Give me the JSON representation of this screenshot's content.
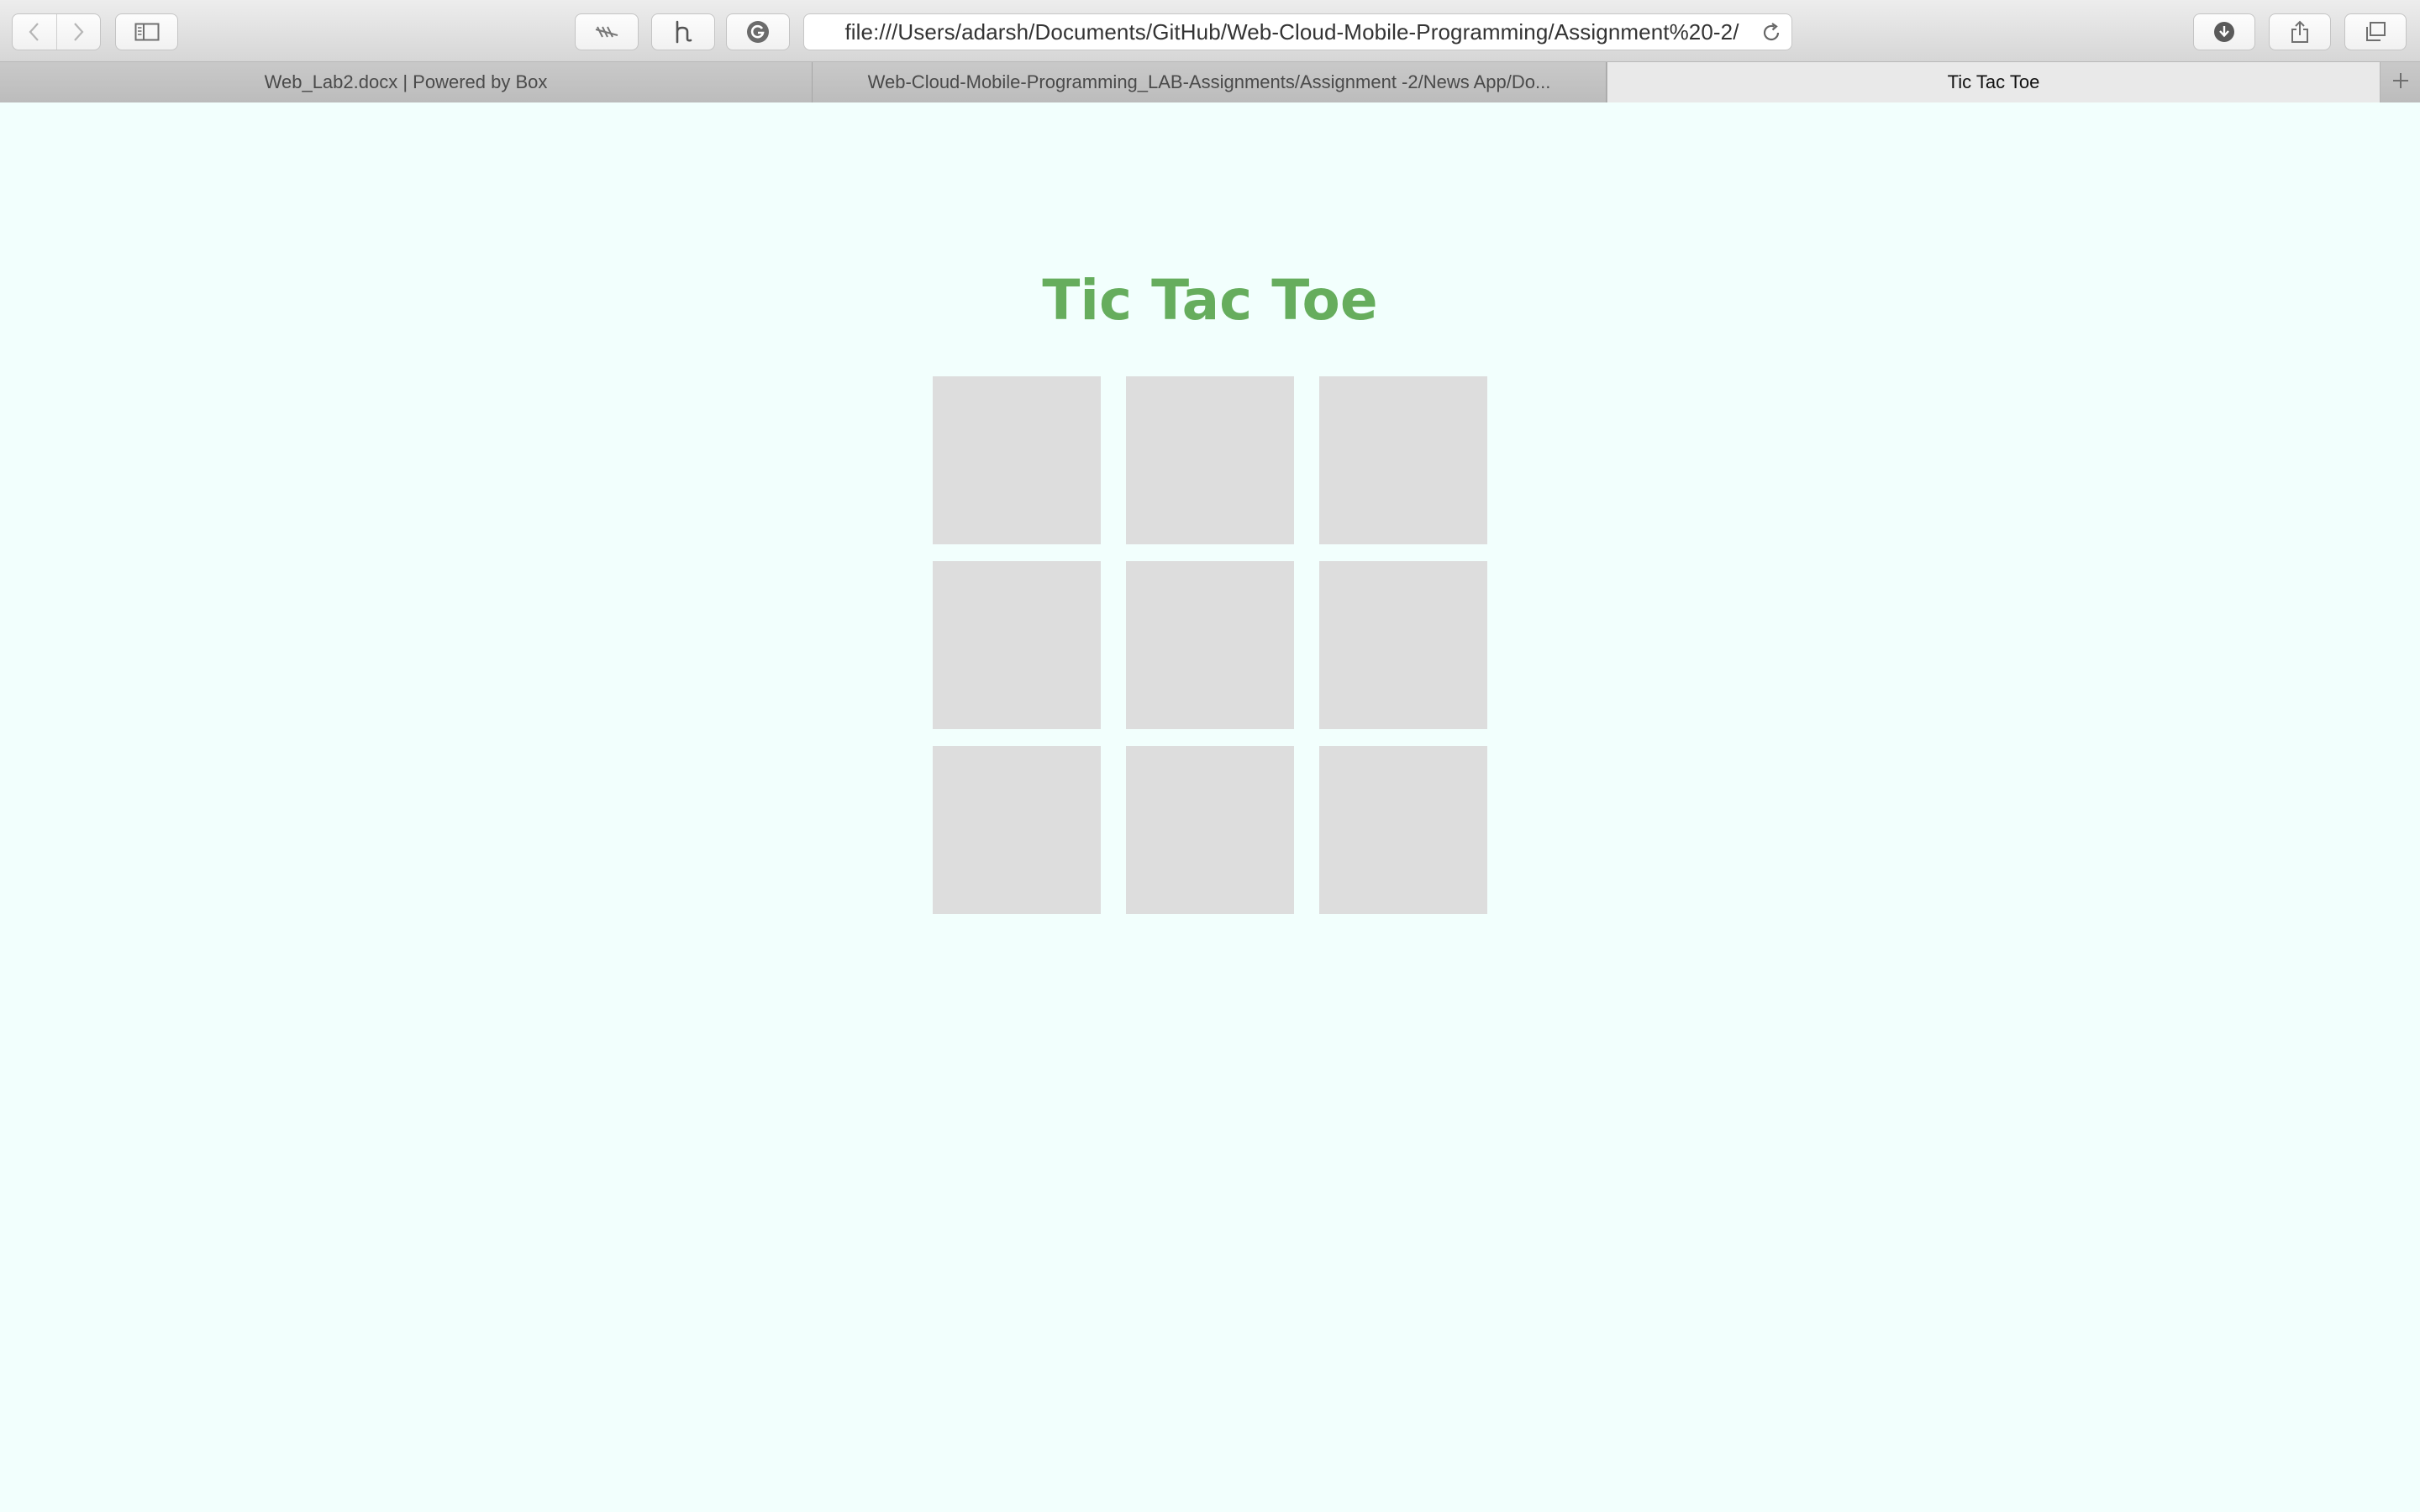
{
  "browser": {
    "address_bar": {
      "url": "file:///Users/adarsh/Documents/GitHub/Web-Cloud-Mobile-Programming/Assignment%20-2/"
    },
    "toolbar": {
      "icons": {
        "back": "chevron-left-icon",
        "forward": "chevron-right-icon",
        "sidebar": "sidebar-icon",
        "extension_1": "strikethrough-icon",
        "extension_2": "hypothesis-icon",
        "extension_3": "grammarly-icon",
        "reload": "reload-icon",
        "downloads": "download-icon",
        "share": "share-icon",
        "tabs_overview": "tabs-overview-icon",
        "new_tab": "plus-icon"
      }
    },
    "tabs": [
      {
        "label": "Web_Lab2.docx | Powered by Box",
        "active": false
      },
      {
        "label": "Web-Cloud-Mobile-Programming_LAB-Assignments/Assignment -2/News App/Do...",
        "active": false
      },
      {
        "label": "Tic Tac Toe",
        "active": true
      }
    ]
  },
  "page": {
    "title": "Tic Tac Toe",
    "board": {
      "cells": [
        "",
        "",
        "",
        "",
        "",
        "",
        "",
        "",
        ""
      ]
    }
  },
  "colors": {
    "page_background": "#f2fffd",
    "title": "#66ad5d",
    "cell": "#dddddd"
  }
}
